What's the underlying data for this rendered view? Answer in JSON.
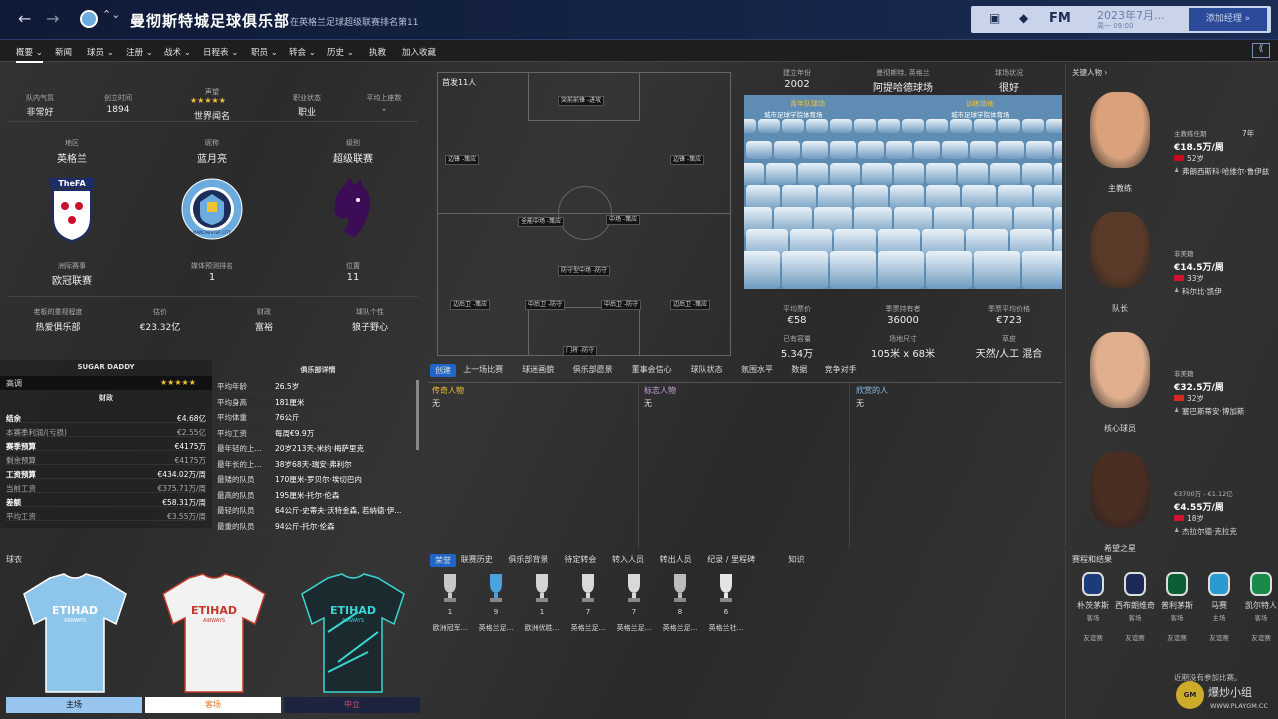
{
  "header": {
    "title": "曼彻斯特城足球俱乐部",
    "subtitle": "在英格兰足球超级联赛排名第11",
    "date": "2023年7月...",
    "date_sub": "周一 09:00",
    "add_manager": "添加经理 »",
    "fm_label": "FM"
  },
  "menu": [
    "概要 ⌄",
    "新闻",
    "球员 ⌄",
    "注册 ⌄",
    "战术 ⌄",
    "日程表 ⌄",
    "职员 ⌄",
    "转会 ⌄",
    "历史 ⌄",
    "执教",
    "加入收藏"
  ],
  "club": {
    "mood_label": "队内气氛",
    "mood": "非常好",
    "founded_label": "创立时间",
    "founded": "1894",
    "rep_label": "声望",
    "rep": "世界闻名",
    "status_label": "职业状态",
    "status": "职业",
    "avg_att_label": "平均上座数",
    "avg_att": "-",
    "region_label": "地区",
    "region": "英格兰",
    "nick_label": "昵称",
    "nick": "蓝月亮",
    "level_label": "级别",
    "level": "超级联赛",
    "cont_label": "洲际赛事",
    "cont": "欧冠联赛",
    "media_label": "媒体预测排名",
    "media": "1",
    "pos_label": "位置",
    "pos": "11",
    "owner_label": "老板的重视程度",
    "owner": "热爱俱乐部",
    "value_label": "估价",
    "value": "€23.32亿",
    "finance_label": "财政",
    "finance": "富裕",
    "pers_label": "球队个性",
    "pers": "狼子野心",
    "fa_text": "TheFA",
    "city_text": "MANCHESTER CITY"
  },
  "lineup": {
    "title": "首发11人",
    "slots": [
      {
        "name": "突前前锋",
        "tag": "-进攻"
      },
      {
        "name": "边锋",
        "tag": "-策应"
      },
      {
        "name": "边锋",
        "tag": "-策应"
      },
      {
        "name": "全能中场",
        "tag": "-策应"
      },
      {
        "name": "中场",
        "tag": "-策应"
      },
      {
        "name": "防守型中场",
        "tag": "-防守"
      },
      {
        "name": "边后卫",
        "tag": "-策应"
      },
      {
        "name": "中后卫",
        "tag": "-防守"
      },
      {
        "name": "中后卫",
        "tag": "-防守"
      },
      {
        "name": "边后卫",
        "tag": "-策应"
      },
      {
        "name": "门将",
        "tag": "-防守"
      }
    ]
  },
  "stadium": {
    "built_label": "建立年份",
    "built": "2002",
    "name_label": "曼彻斯特, 英格兰",
    "name": "阿提哈德球场",
    "cond_label": "球场状况",
    "cond": "很好",
    "youth_label": "青年队球场",
    "youth": "城市足球学院体育场",
    "train_label": "训练场地",
    "train": "城市足球学院体育场",
    "ticket_label": "平均票价",
    "ticket": "€58",
    "season_label": "季票持有者",
    "season": "36000",
    "season_price_label": "季票平均价格",
    "season_price": "€723",
    "cap_label": "已有容量",
    "cap": "5.34万",
    "size_label": "场地尺寸",
    "size": "105米 x 68米",
    "turf_label": "草皮",
    "turf": "天然/人工 混合"
  },
  "finance": {
    "sugar": "SUGAR DADDY",
    "high": "高调",
    "title": "财政",
    "rows": [
      {
        "k": "结余",
        "v": "€4.68亿",
        "bold": true
      },
      {
        "k": "本赛季利润/(亏损)",
        "v": "€2.55亿",
        "bold": false
      },
      {
        "k": "赛季预算",
        "v": "€4175万",
        "bold": true
      },
      {
        "k": "剩余预算",
        "v": "€4175万",
        "bold": false
      },
      {
        "k": "工资预算",
        "v": "€434.02万/周",
        "bold": true
      },
      {
        "k": "当前工资",
        "v": "€375.71万/周",
        "bold": false
      },
      {
        "k": "差额",
        "v": "€58.31万/周",
        "bold": true
      },
      {
        "k": "平均工资",
        "v": "€3.55万/周",
        "bold": false
      }
    ]
  },
  "details": {
    "title": "俱乐部详情",
    "rows": [
      {
        "k": "平均年龄",
        "v": "26.5岁"
      },
      {
        "k": "平均身高",
        "v": "181厘米"
      },
      {
        "k": "平均体重",
        "v": "76公斤"
      },
      {
        "k": "平均工资",
        "v": "每周€9.9万"
      },
      {
        "k": "最年轻的上...",
        "v": "20岁213天-米约·梅萨里克"
      },
      {
        "k": "最年长的上...",
        "v": "38岁68天-瑞安·弗利尔"
      },
      {
        "k": "最矮的队员",
        "v": "170厘米-罗贝尔·埃切巴内"
      },
      {
        "k": "最高的队员",
        "v": "195厘米-托尔·伦森"
      },
      {
        "k": "最轻的队员",
        "v": "64公斤-史蒂夫·沃特金森, 若纳德·伊..."
      },
      {
        "k": "最重的队员",
        "v": "94公斤-托尔·伦森"
      }
    ]
  },
  "midtabs": [
    "创建",
    "上一场比赛",
    "球迷画貌",
    "俱乐部愿景",
    "董事会信心",
    "球队状态",
    "氛围水平",
    "数据",
    "竞争对手"
  ],
  "people": {
    "legend": "传奇人物",
    "icon": "标志人物",
    "fav": "欣赏的人",
    "none": "无"
  },
  "kits": {
    "title": "球衣",
    "home": "主场",
    "away": "客场",
    "third": "中立",
    "etihad": "ETIHAD",
    "airways": "AIRWAYS"
  },
  "histtabs": [
    "荣誉",
    "联赛历史",
    "俱乐部背景",
    "待定转会",
    "转入人员",
    "转出人员",
    "纪录 / 里程碑",
    "知识"
  ],
  "trophies": [
    {
      "n": "1",
      "l": "欧洲冠军..."
    },
    {
      "n": "9",
      "l": "英格兰足..."
    },
    {
      "n": "1",
      "l": "欧洲优胜..."
    },
    {
      "n": "7",
      "l": "英格兰足..."
    },
    {
      "n": "7",
      "l": "英格兰足..."
    },
    {
      "n": "8",
      "l": "英格兰足..."
    },
    {
      "n": "6",
      "l": "英格兰社..."
    }
  ],
  "keypeople": {
    "title": "关键人物 ›",
    "items": [
      {
        "role": "主教练",
        "sub": "主教练任期",
        "yrs": "7年",
        "wage": "€18.5万/周",
        "age": "52岁",
        "name": "弗朗西斯科·哈维尔·鲁伊兹"
      },
      {
        "role": "队长",
        "sub": "非美籍",
        "yrs": "",
        "wage": "€14.5万/周",
        "age": "33岁",
        "name": "科尔比·凯伊"
      },
      {
        "role": "核心球员",
        "sub": "非美籍",
        "yrs": "",
        "wage": "€32.5万/周",
        "age": "32岁",
        "name": "塞巴斯蒂安·博加斯"
      },
      {
        "role": "希望之星",
        "sub": "€3700万 - €1.12亿",
        "yrs": "",
        "wage": "€4.55万/周",
        "age": "18岁",
        "name": "杰拉尔德·克拉克"
      }
    ]
  },
  "fixtures": {
    "title": "赛程和结果",
    "items": [
      {
        "club": "朴茨茅斯",
        "venue": "客场",
        "type": "友谊赛"
      },
      {
        "club": "西布朗维奇",
        "venue": "客场",
        "type": "友谊赛"
      },
      {
        "club": "普利茅斯",
        "venue": "客场",
        "type": "友谊赛"
      },
      {
        "club": "马赛",
        "venue": "主场",
        "type": "友谊赛"
      },
      {
        "club": "凯尔特人",
        "venue": "客场",
        "type": "友谊赛"
      }
    ],
    "note": "近期没有参加比赛。"
  },
  "watermark": {
    "cn": "爆炒小组",
    "url": "WWW.PLAYGM.CC"
  },
  "colors": {
    "accent": "#1e66c7",
    "topbar": "#152447",
    "gold": "#f1c232"
  }
}
